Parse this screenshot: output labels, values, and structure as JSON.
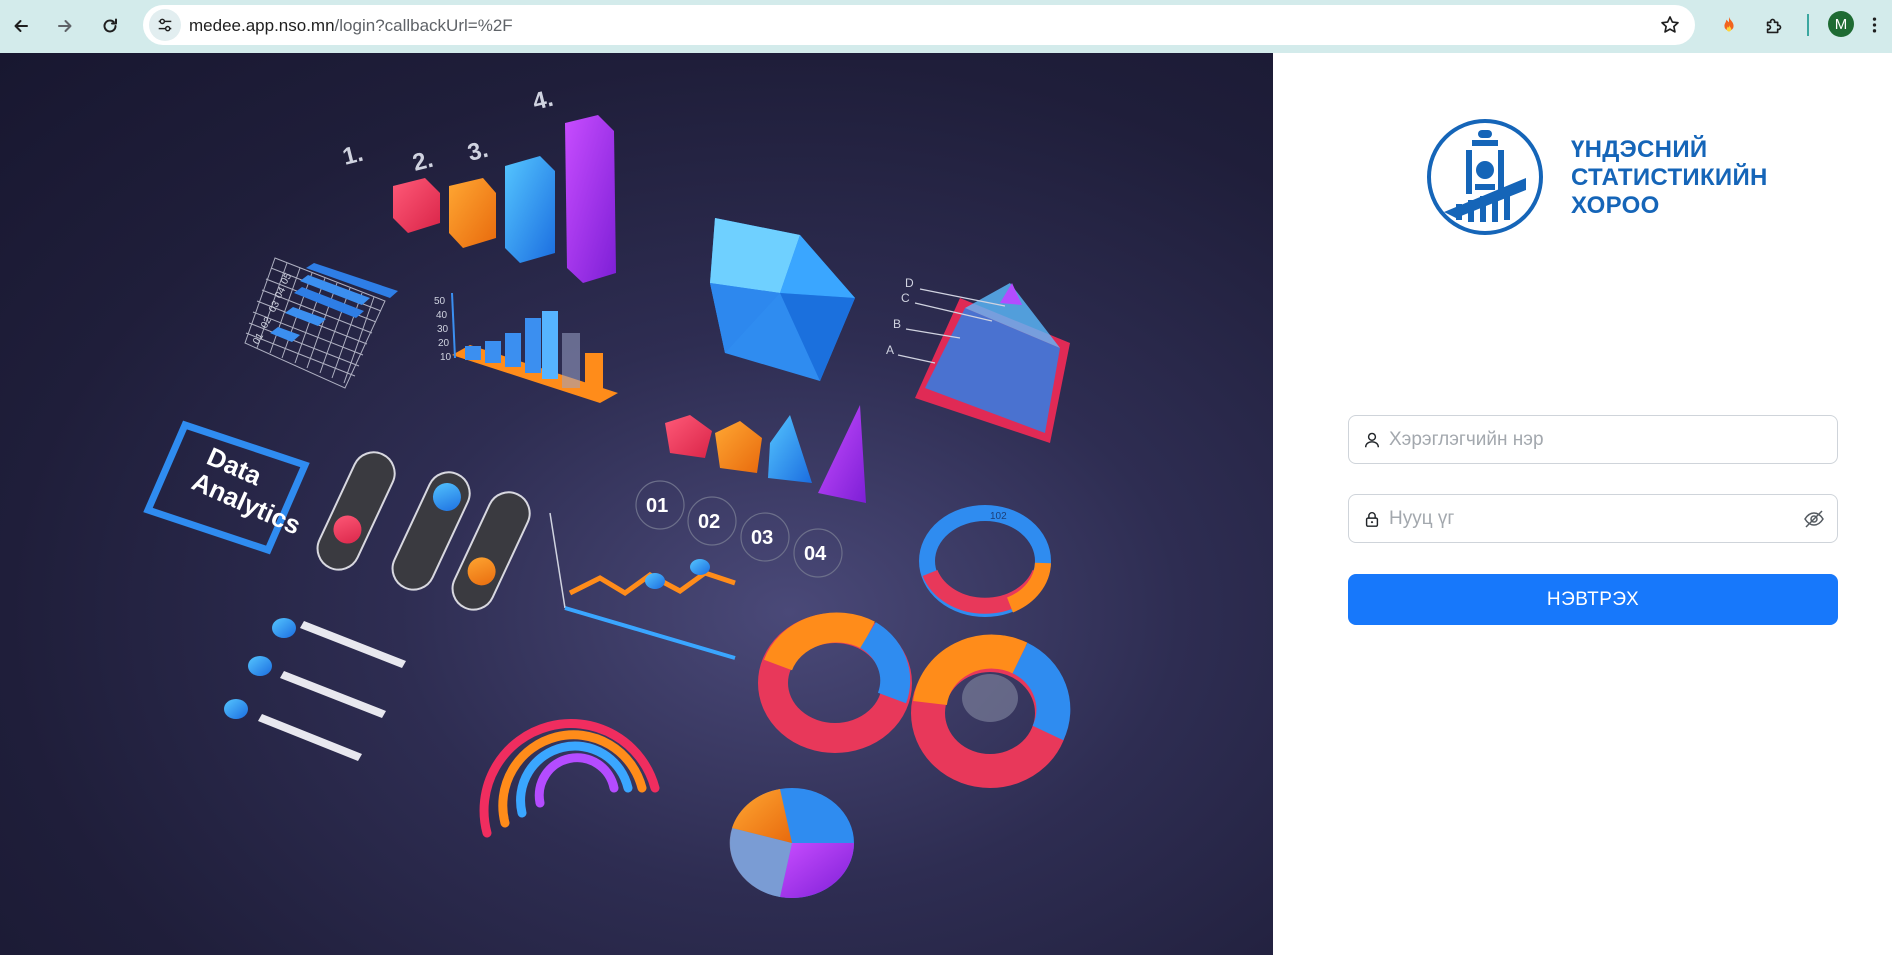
{
  "browser": {
    "url_host": "medee.app.nso.mn",
    "url_path": "/login?callbackUrl=%2F",
    "profile_initial": "M",
    "icons": {
      "back": "arrow-left-icon",
      "forward": "arrow-right-icon",
      "reload": "reload-icon",
      "site_info": "tune-icon",
      "bookmark": "star-icon",
      "extension_1": "flame-extension-icon",
      "extensions": "puzzle-icon",
      "menu": "kebab-menu-icon"
    }
  },
  "hero": {
    "badge_line1": "Data",
    "badge_line2": "Analytics",
    "ranks": [
      "1.",
      "2.",
      "3.",
      "4."
    ],
    "step_labels": [
      "01",
      "02",
      "03",
      "04"
    ],
    "pyramid_levels": [
      "D",
      "C",
      "B",
      "A"
    ],
    "hbar_ticks": [
      "05",
      "04",
      "03",
      "02",
      "01"
    ],
    "vbar_ticks": [
      "50",
      "40",
      "30",
      "20",
      "10"
    ],
    "ring_label": "102"
  },
  "login": {
    "org_line1": "ҮНДЭСНИЙ",
    "org_line2": "СТАТИСТИКИЙН",
    "org_line3": "ХОРОО",
    "username_placeholder": "Хэрэглэгчийн нэр",
    "password_placeholder": "Нууц үг",
    "submit_label": "НЭВТРЭХ",
    "colors": {
      "brand": "#1565b8",
      "button": "#1778fb"
    }
  }
}
